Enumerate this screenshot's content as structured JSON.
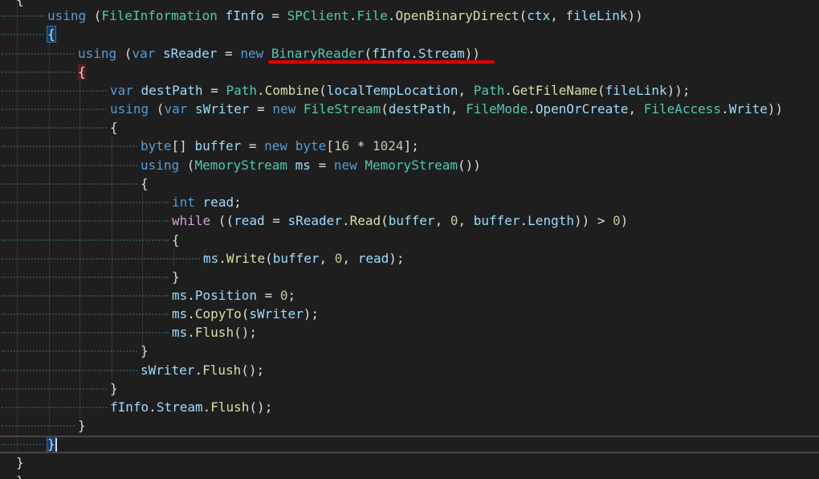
{
  "editor": {
    "lines": [
      [
        {
          "t": "{",
          "c": "pl"
        }
      ],
      [
        {
          "t": "using",
          "c": "kw"
        },
        {
          "t": " (",
          "c": "pl"
        },
        {
          "t": "FileInformation",
          "c": "ty"
        },
        {
          "t": " ",
          "c": "pl"
        },
        {
          "t": "fInfo",
          "c": "vr"
        },
        {
          "t": " = ",
          "c": "pl"
        },
        {
          "t": "SPClient",
          "c": "ty"
        },
        {
          "t": ".",
          "c": "pl"
        },
        {
          "t": "File",
          "c": "ty"
        },
        {
          "t": ".",
          "c": "pl"
        },
        {
          "t": "OpenBinaryDirect",
          "c": "fn"
        },
        {
          "t": "(",
          "c": "pl"
        },
        {
          "t": "ctx",
          "c": "vr"
        },
        {
          "t": ", ",
          "c": "pl"
        },
        {
          "t": "fileLink",
          "c": "vr"
        },
        {
          "t": "))",
          "c": "pl"
        }
      ],
      [
        {
          "t": "{",
          "c": "pl brace-match"
        }
      ],
      [
        {
          "t": "using",
          "c": "kw"
        },
        {
          "t": " (",
          "c": "pl"
        },
        {
          "t": "var",
          "c": "kw"
        },
        {
          "t": " ",
          "c": "pl"
        },
        {
          "t": "sReader",
          "c": "vr"
        },
        {
          "t": " = ",
          "c": "pl"
        },
        {
          "t": "new",
          "c": "kw"
        },
        {
          "t": " ",
          "c": "pl"
        },
        {
          "t": "BinaryReader",
          "c": "ty"
        },
        {
          "t": "(",
          "c": "pl"
        },
        {
          "t": "fInfo",
          "c": "vr"
        },
        {
          "t": ".",
          "c": "pl"
        },
        {
          "t": "Stream",
          "c": "vr"
        },
        {
          "t": "))",
          "c": "pl"
        }
      ],
      [
        {
          "t": "{",
          "c": "pl brace-match-red"
        }
      ],
      [
        {
          "t": "var",
          "c": "kw"
        },
        {
          "t": " ",
          "c": "pl"
        },
        {
          "t": "destPath",
          "c": "vr"
        },
        {
          "t": " = ",
          "c": "pl"
        },
        {
          "t": "Path",
          "c": "ty"
        },
        {
          "t": ".",
          "c": "pl"
        },
        {
          "t": "Combine",
          "c": "fn"
        },
        {
          "t": "(",
          "c": "pl"
        },
        {
          "t": "localTempLocation",
          "c": "vr"
        },
        {
          "t": ", ",
          "c": "pl"
        },
        {
          "t": "Path",
          "c": "ty"
        },
        {
          "t": ".",
          "c": "pl"
        },
        {
          "t": "GetFileName",
          "c": "fn"
        },
        {
          "t": "(",
          "c": "pl"
        },
        {
          "t": "fileLink",
          "c": "vr"
        },
        {
          "t": "));",
          "c": "pl"
        }
      ],
      [
        {
          "t": "using",
          "c": "kw"
        },
        {
          "t": " (",
          "c": "pl"
        },
        {
          "t": "var",
          "c": "kw"
        },
        {
          "t": " ",
          "c": "pl"
        },
        {
          "t": "sWriter",
          "c": "vr"
        },
        {
          "t": " = ",
          "c": "pl"
        },
        {
          "t": "new",
          "c": "kw"
        },
        {
          "t": " ",
          "c": "pl"
        },
        {
          "t": "FileStream",
          "c": "ty"
        },
        {
          "t": "(",
          "c": "pl"
        },
        {
          "t": "destPath",
          "c": "vr"
        },
        {
          "t": ", ",
          "c": "pl"
        },
        {
          "t": "FileMode",
          "c": "ty"
        },
        {
          "t": ".",
          "c": "pl"
        },
        {
          "t": "OpenOrCreate",
          "c": "vr"
        },
        {
          "t": ", ",
          "c": "pl"
        },
        {
          "t": "FileAccess",
          "c": "ty"
        },
        {
          "t": ".",
          "c": "pl"
        },
        {
          "t": "Write",
          "c": "vr"
        },
        {
          "t": "))",
          "c": "pl"
        }
      ],
      [
        {
          "t": "{",
          "c": "pl"
        }
      ],
      [
        {
          "t": "byte",
          "c": "kw"
        },
        {
          "t": "[] ",
          "c": "pl"
        },
        {
          "t": "buffer",
          "c": "vr"
        },
        {
          "t": " = ",
          "c": "pl"
        },
        {
          "t": "new",
          "c": "kw"
        },
        {
          "t": " ",
          "c": "pl"
        },
        {
          "t": "byte",
          "c": "kw"
        },
        {
          "t": "[",
          "c": "pl"
        },
        {
          "t": "16",
          "c": "nm"
        },
        {
          "t": " * ",
          "c": "pl"
        },
        {
          "t": "1024",
          "c": "nm"
        },
        {
          "t": "];",
          "c": "pl"
        }
      ],
      [
        {
          "t": "using",
          "c": "kw"
        },
        {
          "t": " (",
          "c": "pl"
        },
        {
          "t": "MemoryStream",
          "c": "ty"
        },
        {
          "t": " ",
          "c": "pl"
        },
        {
          "t": "ms",
          "c": "vr"
        },
        {
          "t": " = ",
          "c": "pl"
        },
        {
          "t": "new",
          "c": "kw"
        },
        {
          "t": " ",
          "c": "pl"
        },
        {
          "t": "MemoryStream",
          "c": "ty"
        },
        {
          "t": "())",
          "c": "pl"
        }
      ],
      [
        {
          "t": "{",
          "c": "pl"
        }
      ],
      [
        {
          "t": "int",
          "c": "kw"
        },
        {
          "t": " ",
          "c": "pl"
        },
        {
          "t": "read",
          "c": "vr"
        },
        {
          "t": ";",
          "c": "pl"
        }
      ],
      [
        {
          "t": "while",
          "c": "ctl"
        },
        {
          "t": " ((",
          "c": "pl"
        },
        {
          "t": "read",
          "c": "vr"
        },
        {
          "t": " = ",
          "c": "pl"
        },
        {
          "t": "sReader",
          "c": "vr"
        },
        {
          "t": ".",
          "c": "pl"
        },
        {
          "t": "Read",
          "c": "fn"
        },
        {
          "t": "(",
          "c": "pl"
        },
        {
          "t": "buffer",
          "c": "vr"
        },
        {
          "t": ", ",
          "c": "pl"
        },
        {
          "t": "0",
          "c": "nm"
        },
        {
          "t": ", ",
          "c": "pl"
        },
        {
          "t": "buffer",
          "c": "vr"
        },
        {
          "t": ".",
          "c": "pl"
        },
        {
          "t": "Length",
          "c": "vr"
        },
        {
          "t": ")) > ",
          "c": "pl"
        },
        {
          "t": "0",
          "c": "nm"
        },
        {
          "t": ")",
          "c": "pl"
        }
      ],
      [
        {
          "t": "{",
          "c": "pl"
        }
      ],
      [
        {
          "t": "ms",
          "c": "vr"
        },
        {
          "t": ".",
          "c": "pl"
        },
        {
          "t": "Write",
          "c": "fn"
        },
        {
          "t": "(",
          "c": "pl"
        },
        {
          "t": "buffer",
          "c": "vr"
        },
        {
          "t": ", ",
          "c": "pl"
        },
        {
          "t": "0",
          "c": "nm"
        },
        {
          "t": ", ",
          "c": "pl"
        },
        {
          "t": "read",
          "c": "vr"
        },
        {
          "t": ");",
          "c": "pl"
        }
      ],
      [
        {
          "t": "}",
          "c": "pl"
        }
      ],
      [
        {
          "t": "ms",
          "c": "vr"
        },
        {
          "t": ".",
          "c": "pl"
        },
        {
          "t": "Position",
          "c": "vr"
        },
        {
          "t": " = ",
          "c": "pl"
        },
        {
          "t": "0",
          "c": "nm"
        },
        {
          "t": ";",
          "c": "pl"
        }
      ],
      [
        {
          "t": "ms",
          "c": "vr"
        },
        {
          "t": ".",
          "c": "pl"
        },
        {
          "t": "CopyTo",
          "c": "fn"
        },
        {
          "t": "(",
          "c": "pl"
        },
        {
          "t": "sWriter",
          "c": "vr"
        },
        {
          "t": ");",
          "c": "pl"
        }
      ],
      [
        {
          "t": "ms",
          "c": "vr"
        },
        {
          "t": ".",
          "c": "pl"
        },
        {
          "t": "Flush",
          "c": "fn"
        },
        {
          "t": "();",
          "c": "pl"
        }
      ],
      [
        {
          "t": "}",
          "c": "pl"
        }
      ],
      [
        {
          "t": "sWriter",
          "c": "vr"
        },
        {
          "t": ".",
          "c": "pl"
        },
        {
          "t": "Flush",
          "c": "fn"
        },
        {
          "t": "();",
          "c": "pl"
        }
      ],
      [
        {
          "t": "}",
          "c": "pl"
        }
      ],
      [
        {
          "t": "fInfo",
          "c": "vr"
        },
        {
          "t": ".",
          "c": "pl"
        },
        {
          "t": "Stream",
          "c": "vr"
        },
        {
          "t": ".",
          "c": "pl"
        },
        {
          "t": "Flush",
          "c": "fn"
        },
        {
          "t": "();",
          "c": "pl"
        }
      ],
      [
        {
          "t": "}",
          "c": "pl"
        }
      ],
      [
        {
          "t": "}",
          "c": "pl brace-match"
        }
      ],
      [
        {
          "t": "}",
          "c": "pl"
        }
      ],
      [
        {
          "t": "}",
          "c": "pl"
        }
      ]
    ],
    "annotation_color": "#e10000"
  }
}
